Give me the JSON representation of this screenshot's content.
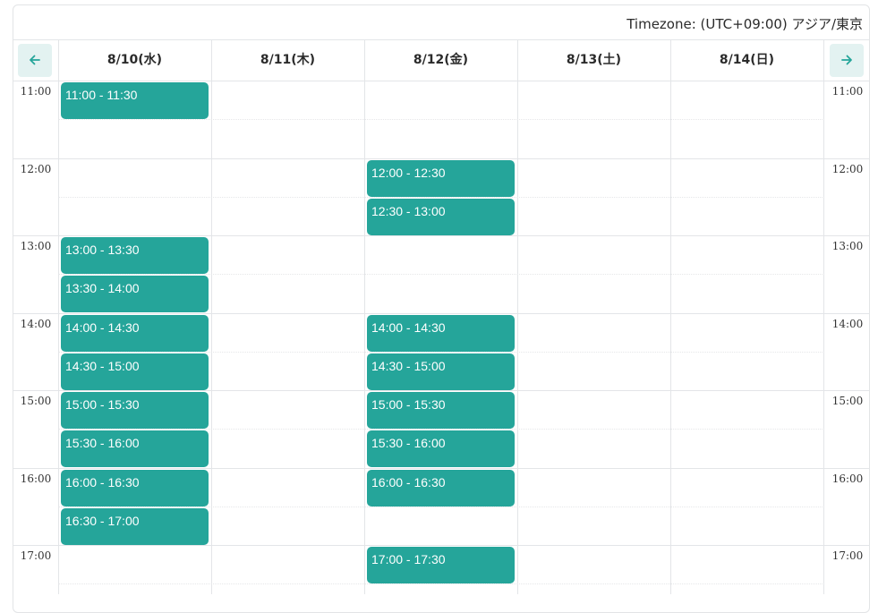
{
  "timezone_label": "Timezone: (UTC+09:00) アジア/東京",
  "days": [
    "8/10(水)",
    "8/11(木)",
    "8/12(金)",
    "8/13(土)",
    "8/14(日)"
  ],
  "hours": [
    "11:00",
    "12:00",
    "13:00",
    "14:00",
    "15:00",
    "16:00",
    "17:00"
  ],
  "slots": [
    {
      "day": 0,
      "label": "11:00 - 11:30"
    },
    {
      "day": 0,
      "label": "13:00 - 13:30"
    },
    {
      "day": 0,
      "label": "13:30 - 14:00"
    },
    {
      "day": 0,
      "label": "14:00 - 14:30"
    },
    {
      "day": 0,
      "label": "14:30 - 15:00"
    },
    {
      "day": 0,
      "label": "15:00 - 15:30"
    },
    {
      "day": 0,
      "label": "15:30 - 16:00"
    },
    {
      "day": 0,
      "label": "16:00 - 16:30"
    },
    {
      "day": 0,
      "label": "16:30 - 17:00"
    },
    {
      "day": 2,
      "label": "12:00 - 12:30"
    },
    {
      "day": 2,
      "label": "12:30 - 13:00"
    },
    {
      "day": 2,
      "label": "14:00 - 14:30"
    },
    {
      "day": 2,
      "label": "14:30 - 15:00"
    },
    {
      "day": 2,
      "label": "15:00 - 15:30"
    },
    {
      "day": 2,
      "label": "15:30 - 16:00"
    },
    {
      "day": 2,
      "label": "16:00 - 16:30"
    },
    {
      "day": 2,
      "label": "17:00 - 17:30"
    }
  ],
  "icons": {
    "prev": "arrow-left-icon",
    "next": "arrow-right-icon"
  },
  "colors": {
    "accent": "#25a59a",
    "nav_bg": "#e3f2f1",
    "grid": "#e3e5e8"
  }
}
